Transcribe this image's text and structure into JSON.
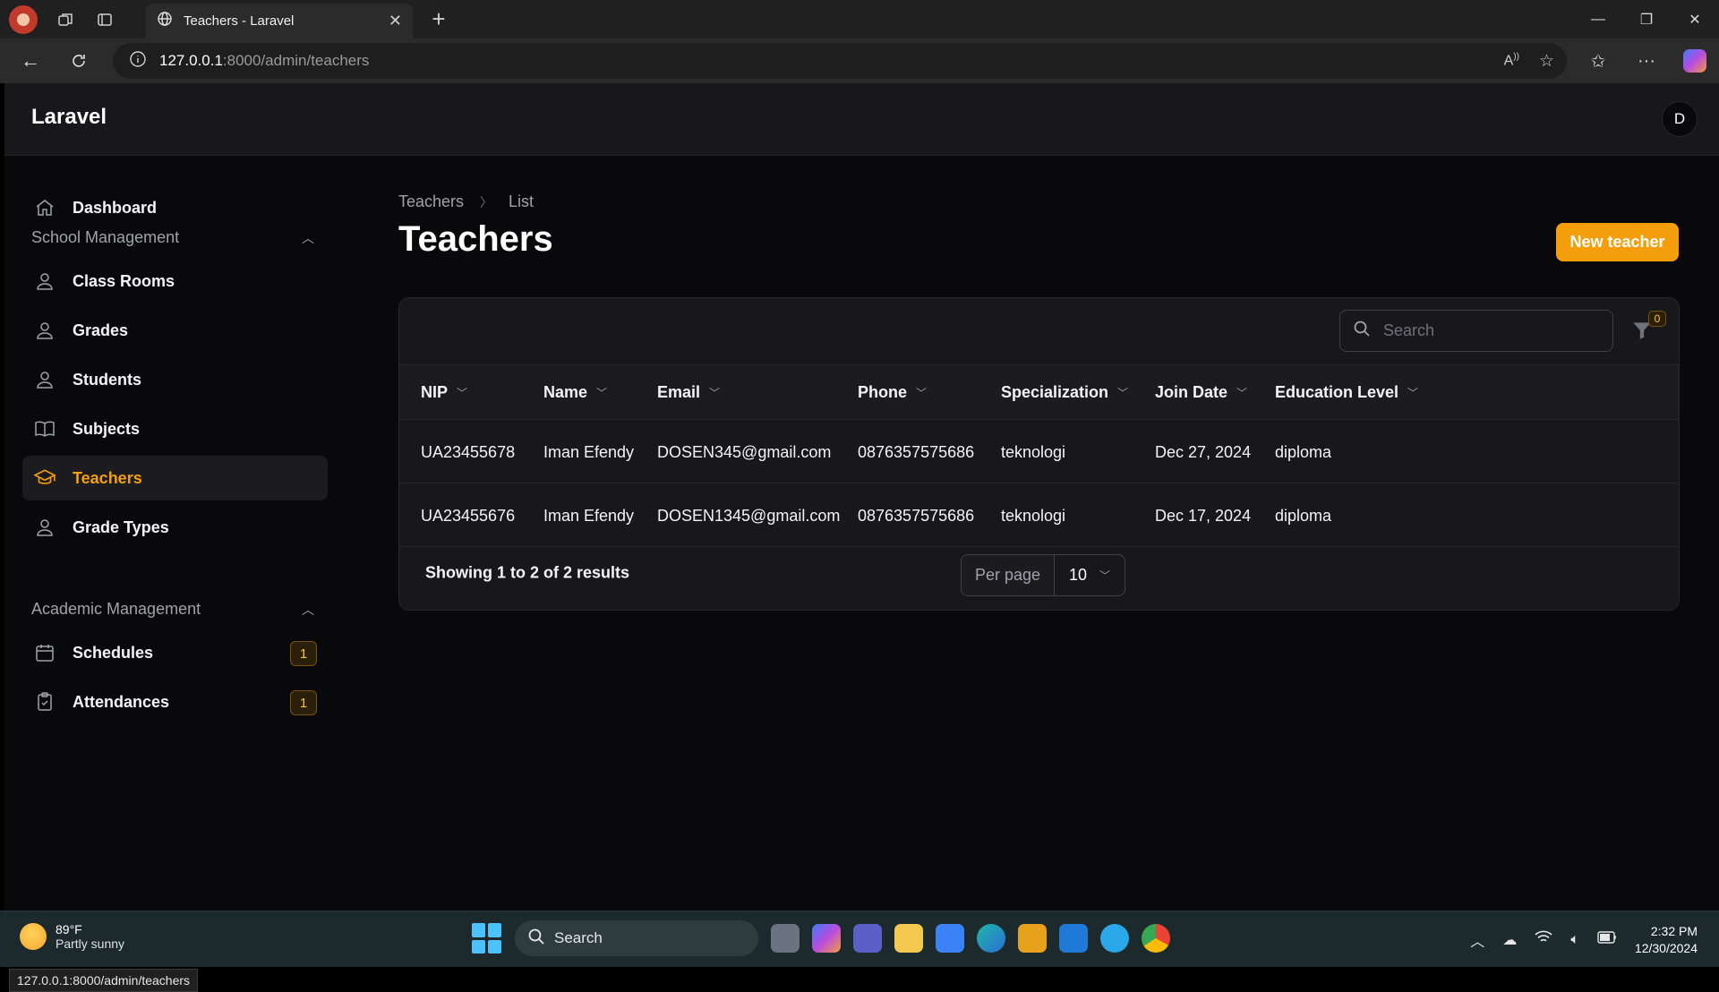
{
  "browser": {
    "tab_title": "Teachers - Laravel",
    "url_host": "127.0.0.1",
    "url_path": ":8000/admin/teachers",
    "status_url": "127.0.0.1:8000/admin/teachers"
  },
  "app": {
    "brand": "Laravel",
    "user_initial": "D"
  },
  "sidebar": {
    "dashboard": "Dashboard",
    "group_school": "School Management",
    "school_items": [
      {
        "label": "Class Rooms",
        "icon": "user-icon"
      },
      {
        "label": "Grades",
        "icon": "user-icon"
      },
      {
        "label": "Students",
        "icon": "user-icon"
      },
      {
        "label": "Subjects",
        "icon": "book-open-icon"
      },
      {
        "label": "Teachers",
        "icon": "academic-cap-icon"
      },
      {
        "label": "Grade Types",
        "icon": "user-icon"
      }
    ],
    "group_academic": "Academic Management",
    "academic_items": [
      {
        "label": "Schedules",
        "icon": "calendar-icon",
        "badge": "1"
      },
      {
        "label": "Attendances",
        "icon": "clipboard-check-icon",
        "badge": "1"
      }
    ],
    "active_item": "Teachers"
  },
  "page": {
    "breadcrumb": [
      "Teachers",
      "List"
    ],
    "title": "Teachers",
    "new_button": "New teacher"
  },
  "table": {
    "search_placeholder": "Search",
    "filter_count": "0",
    "columns": [
      "NIP",
      "Name",
      "Email",
      "Phone",
      "Specialization",
      "Join Date",
      "Education Level"
    ],
    "rows": [
      [
        "UA23455678",
        "Iman Efendy",
        "DOSEN345@gmail.com",
        "0876357575686",
        "teknologi",
        "Dec 27, 2024",
        "diploma"
      ],
      [
        "UA23455676",
        "Iman Efendy",
        "DOSEN1345@gmail.com",
        "0876357575686",
        "teknologi",
        "Dec 17, 2024",
        "diploma"
      ]
    ],
    "summary": "Showing 1 to 2 of 2 results",
    "per_page_label": "Per page",
    "per_page_value": "10"
  },
  "taskbar": {
    "temp": "89°F",
    "condition": "Partly sunny",
    "search": "Search",
    "time": "2:32 PM",
    "date": "12/30/2024"
  },
  "colors": {
    "accent": "#f59e0b",
    "background": "#09090b",
    "panel": "#18181b"
  }
}
